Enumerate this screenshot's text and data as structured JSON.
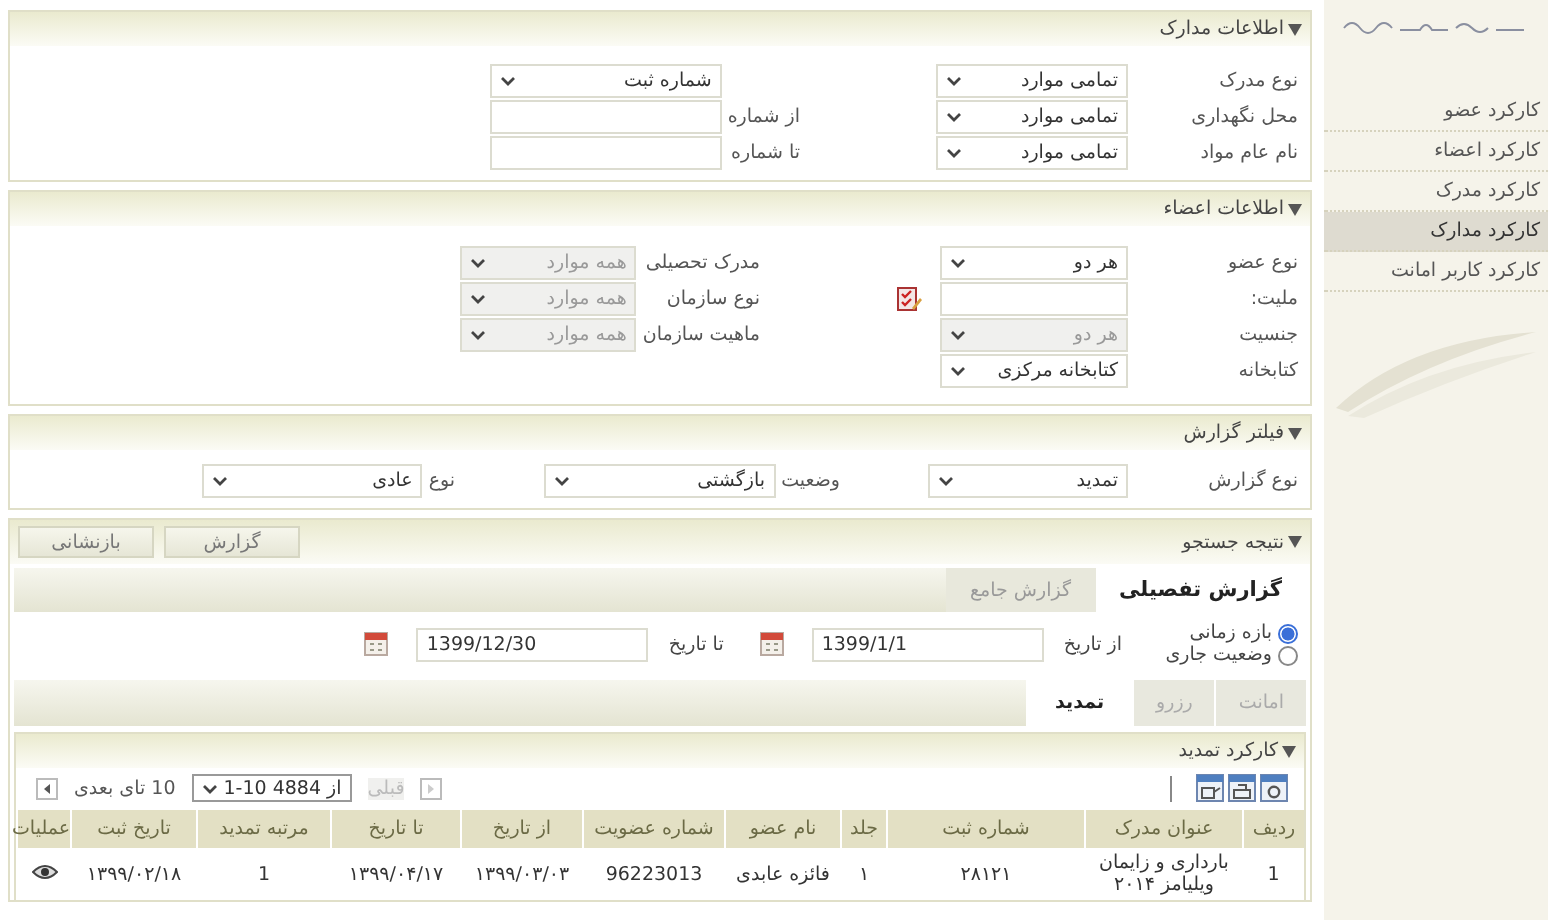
{
  "sidebar": {
    "items": [
      {
        "label": "کارکرد عضو",
        "selected": false
      },
      {
        "label": "کارکرد اعضاء",
        "selected": false
      },
      {
        "label": "کارکرد مدرک",
        "selected": false
      },
      {
        "label": "کارکرد مدارک",
        "selected": true
      },
      {
        "label": "کارکرد کاربر امانت",
        "selected": false
      }
    ]
  },
  "sections": [
    {
      "title": "اطلاعات مدارک",
      "expanded": true,
      "columns": [
        [
          {
            "kind": "select",
            "label": "نوع مدرک",
            "value": "تمامی موارد",
            "disabled": false
          },
          {
            "kind": "select",
            "label": "محل نگهداری",
            "value": "تمامی موارد",
            "disabled": false
          },
          {
            "kind": "select",
            "label": "نام عام مواد",
            "value": "تمامی موارد",
            "disabled": false
          }
        ],
        [
          {
            "kind": "select",
            "value": "شماره ثبت",
            "disabled": false
          },
          {
            "kind": "input",
            "label": "از شماره",
            "disabled": false
          },
          {
            "kind": "input",
            "label": "تا شماره",
            "disabled": false
          }
        ]
      ]
    },
    {
      "title": "اطلاعات اعضاء",
      "expanded": true,
      "columns": [
        [
          {
            "kind": "select",
            "label": "نوع عضو",
            "value": "هر دو",
            "disabled": false
          },
          {
            "kind": "lookup",
            "label": "ملیت:",
            "disabled": false
          },
          {
            "kind": "select",
            "label": "جنسیت",
            "value": "هر دو",
            "disabled": true
          },
          {
            "kind": "select",
            "label": "کتابخانه",
            "value": "کتابخانه مرکزی",
            "disabled": false
          }
        ],
        [
          {
            "kind": "select",
            "label": "مدرک تحصیلی",
            "value": "همه موارد",
            "disabled": true
          },
          {
            "kind": "select",
            "label": "نوع سازمان",
            "value": "همه موارد",
            "disabled": true
          },
          {
            "kind": "select",
            "label": "ماهیت سازمان",
            "value": "همه موارد",
            "disabled": true
          }
        ]
      ]
    },
    {
      "title": "فیلتر گزارش",
      "expanded": true,
      "columns": [
        [
          {
            "kind": "select",
            "label": "نوع گزارش",
            "value": "تمدید",
            "disabled": false
          }
        ],
        [
          {
            "kind": "select",
            "label": "وضعیت",
            "value": "بازگشتی",
            "disabled": false
          }
        ],
        [
          {
            "kind": "select",
            "label": "نوع",
            "value": "عادی",
            "disabled": false
          }
        ]
      ]
    }
  ],
  "results": {
    "title": "نتیجه جستجو",
    "expanded": true,
    "buttons": [
      "گزارش",
      "بازنشانی"
    ],
    "report_tabs": [
      {
        "label": "گزارش تفصیلی",
        "selected": true
      },
      {
        "label": "گزارش جامع",
        "selected": false
      }
    ],
    "range_options": [
      {
        "label": "بازه زمانی",
        "selected": true
      },
      {
        "label": "وضعیت جاری",
        "selected": false
      }
    ],
    "date_fields": [
      {
        "label": "از تاریخ",
        "value": "1399/1/1"
      },
      {
        "label": "تا تاریخ",
        "value": "1399/12/30"
      }
    ],
    "type_tabs": [
      {
        "label": "امانت",
        "selected": false
      },
      {
        "label": "رزرو",
        "selected": false
      },
      {
        "label": "تمدید",
        "selected": true
      }
    ],
    "panel": {
      "title": "کارکرد تمدید",
      "expanded": true,
      "pager": {
        "previous_label": "قبلی",
        "previous_disabled": true,
        "range": "1-10 از 4884",
        "next_label": "10 تای بعدی",
        "next_disabled": false
      },
      "table": {
        "columns": [
          "ردیف",
          "عنوان مدرک",
          "شماره ثبت",
          "جلد",
          "نام عضو",
          "شماره عضویت",
          "از تاریخ",
          "تا تاریخ",
          "مرتبه تمدید",
          "تاریخ ثبت",
          "عملیات"
        ],
        "rows": [
          [
            "1",
            "بارداری و زایمان ویلیامز ۲۰۱۴",
            "۲۸۱۲۱",
            "۱",
            "فائزه عابدی",
            "96223013",
            "۱۳۹۹/۰۳/۰۳",
            "۱۳۹۹/۰۴/۱۷",
            "1",
            "۱۳۹۹/۰۲/۱۸"
          ]
        ]
      }
    }
  }
}
